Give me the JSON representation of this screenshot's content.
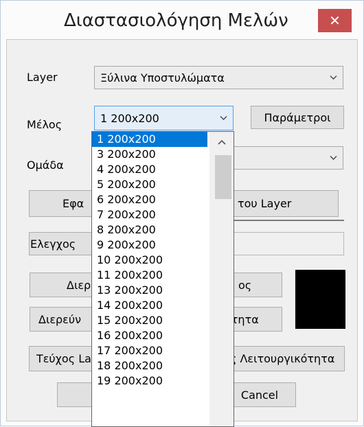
{
  "window": {
    "title": "Διαστασιολόγηση Μελών",
    "close_glyph": "✕"
  },
  "form": {
    "layer_label": "Layer",
    "layer_value": "Ξύλινα Υποστυλώματα",
    "member_label": "Μέλος",
    "member_value": "1 200x200",
    "group_label": "Ομάδα",
    "params_button": "Παράμετροι",
    "apply_layer_button": "Εφα",
    "apply_layer_button_right": "του Layer",
    "check_button": "Ελεγχος",
    "investigate_button": "Διερ",
    "investigate_button_right": "ος",
    "investigate2_button": "Διερεύν",
    "investigate2_button_right": "ότητα",
    "report_button": "Τεύχος La",
    "report_button_right": "ς Λειτουργικότητα",
    "cancel_button": "Cancel"
  },
  "dropdown": {
    "items": [
      "1 200x200",
      "3 200x200",
      "4 200x200",
      "5 200x200",
      "6 200x200",
      "7 200x200",
      "8 200x200",
      "9 200x200",
      "10 200x200",
      "11 200x200",
      "13 200x200",
      "14 200x200",
      "15 200x200",
      "16 200x200",
      "17 200x200",
      "18 200x200",
      "19 200x200"
    ],
    "selected_index": 0
  },
  "colors": {
    "accent": "#0078d7",
    "close": "#c74f50",
    "swatch": "#000000"
  },
  "icons": {
    "chevron": "chevron-down-icon",
    "scroll_up": "chevron-up-icon",
    "close": "close-icon"
  }
}
